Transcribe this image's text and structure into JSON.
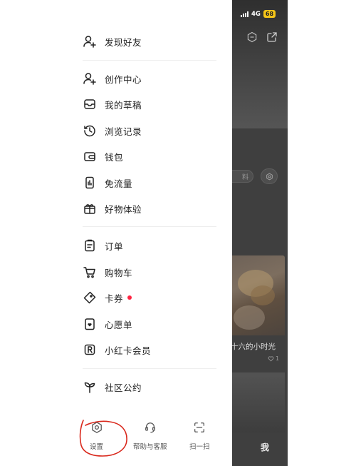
{
  "drawer": {
    "groups": [
      [
        {
          "label": "发现好友",
          "icon": "add-friend-icon"
        }
      ],
      [
        {
          "label": "创作中心",
          "icon": "creator-icon"
        },
        {
          "label": "我的草稿",
          "icon": "drafts-icon"
        },
        {
          "label": "浏览记录",
          "icon": "history-icon"
        },
        {
          "label": "钱包",
          "icon": "wallet-icon"
        },
        {
          "label": "免流量",
          "icon": "free-data-icon"
        },
        {
          "label": "好物体验",
          "icon": "gift-icon"
        }
      ],
      [
        {
          "label": "订单",
          "icon": "order-icon"
        },
        {
          "label": "购物车",
          "icon": "cart-icon"
        },
        {
          "label": "卡券",
          "icon": "coupon-icon",
          "badge_dot": true
        },
        {
          "label": "心愿单",
          "icon": "wishlist-icon"
        },
        {
          "label": "小红卡会员",
          "icon": "membership-icon"
        }
      ],
      [
        {
          "label": "社区公约",
          "icon": "sprout-icon"
        }
      ]
    ],
    "bottom": {
      "settings": "设置",
      "help": "帮助与客服",
      "scan": "扫一扫"
    }
  },
  "background_app": {
    "status_bar": {
      "network": "4G",
      "battery": "68"
    },
    "chip_text": "料",
    "card_caption": "十六的小时光",
    "card_likes": "1",
    "bottom_tab_me": "我"
  },
  "colors": {
    "badge_dot": "#ff2442",
    "annotation": "#d9281c",
    "battery": "#f5c518"
  }
}
